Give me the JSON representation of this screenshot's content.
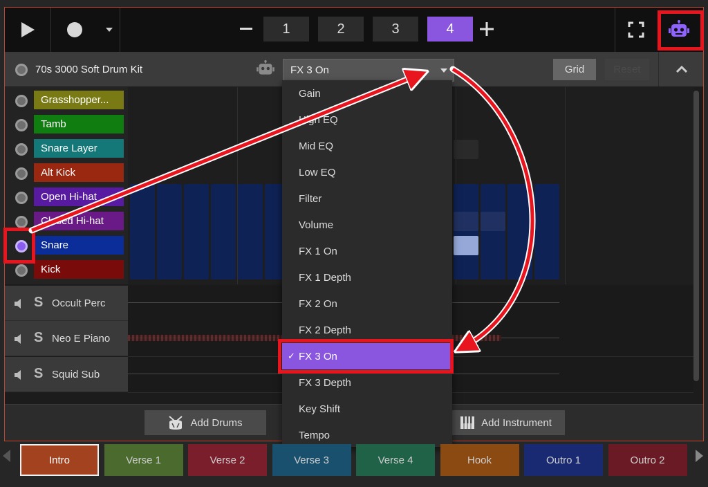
{
  "topbar": {
    "tabs": [
      "1",
      "2",
      "3",
      "4"
    ],
    "active_tab": "4"
  },
  "header": {
    "kit_name": "70s 3000 Soft Drum Kit",
    "select_value": "FX 3 On",
    "grid_label": "Grid",
    "reset_label": "Reset"
  },
  "drums": [
    {
      "label": "Grasshopper...",
      "color": "#7a7a14"
    },
    {
      "label": "Tamb",
      "color": "#107d10"
    },
    {
      "label": "Snare Layer",
      "color": "#157878"
    },
    {
      "label": "Alt Kick",
      "color": "#9a2810"
    },
    {
      "label": "Open Hi-hat",
      "color": "#581aa0"
    },
    {
      "label": "Closed Hi-hat",
      "color": "#6a1a86"
    },
    {
      "label": "Snare",
      "color": "#0b2d9a"
    },
    {
      "label": "Kick",
      "color": "#7a0b0b"
    }
  ],
  "instruments": [
    {
      "name": "Occult Perc"
    },
    {
      "name": "Neo E Piano"
    },
    {
      "name": "Squid Sub"
    }
  ],
  "bottom": {
    "add_drums": "Add Drums",
    "add_instrument": "Add Instrument"
  },
  "dropdown": {
    "options": [
      "Gain",
      "High EQ",
      "Mid EQ",
      "Low EQ",
      "Filter",
      "Volume",
      "FX 1 On",
      "FX 1 Depth",
      "FX 2 On",
      "FX 2 Depth",
      "FX 3 On",
      "FX 3 Depth",
      "Key Shift",
      "Tempo"
    ],
    "selected": "FX 3 On",
    "check": "✓"
  },
  "sections": [
    {
      "label": "Intro",
      "color": "#a3421e"
    },
    {
      "label": "Verse 1",
      "color": "#4a6a2e"
    },
    {
      "label": "Verse 2",
      "color": "#7a1e2c"
    },
    {
      "label": "Verse 3",
      "color": "#18506e"
    },
    {
      "label": "Verse 4",
      "color": "#206248"
    },
    {
      "label": "Hook",
      "color": "#8a4a12"
    },
    {
      "label": "Outro 1",
      "color": "#1a2a72"
    },
    {
      "label": "Outro 2",
      "color": "#6a1a24"
    }
  ],
  "colors": {
    "accent": "#8a56e0",
    "highlight_red": "#e8141e"
  }
}
